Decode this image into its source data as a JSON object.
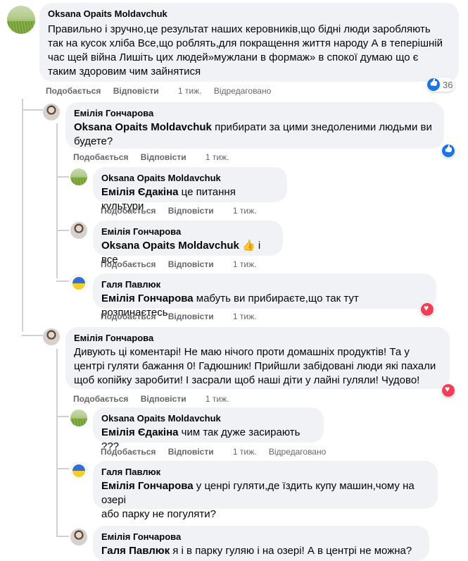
{
  "actions": {
    "like": "Подобається",
    "reply": "Відповісти"
  },
  "colors": {
    "like_blue": "#1b74e4",
    "love_red": "#f33e58",
    "bubble_bg": "#f0f2f5",
    "meta_gray": "#65676b"
  },
  "comments": [
    {
      "author": "Oksana Opaits Moldavchuk",
      "lines": [
        "Правильно і зручно,це результат наших керовників,що бідні люди заробляють",
        "так на кусок хліба Все,що роблять,для покращення життя народу А в теперішній",
        "час щей війна Лишіть цих людей»мужлани в формаж» в спокої думаю що є",
        "таким здоровим чим зайнятися"
      ],
      "time": "1 тиж.",
      "edited": "Відредаговано",
      "reaction_icon": "like-icon",
      "reaction_count": "36"
    },
    {
      "author": "Емілія Гончарова",
      "mention": "Oksana Opaits Moldavchuk",
      "line1_rest": " прибирати за цими знедоленими людьми ви",
      "line2": "будете?",
      "time": "1 тиж.",
      "reaction_icon": "like-icon"
    },
    {
      "author": "Oksana Opaits Moldavchuk",
      "mention": "Емілія Єдакіна",
      "rest": " це питання культури",
      "time": "1 тиж."
    },
    {
      "author": "Емілія Гончарова",
      "mention": "Oksana Opaits Moldavchuk",
      "emoji": "👍",
      "rest": " і все",
      "time": "1 тиж."
    },
    {
      "author": "Галя Павлюк",
      "mention": "Емілія Гончарова",
      "rest": " мабуть ви прибираєте,що так тут розпинаєтесь.",
      "time": "1 тиж.",
      "reaction_icon": "love-icon"
    },
    {
      "author": "Емілія Гончарова",
      "lines": [
        "Дивують ці коментарі! Не маю нічого проти домашніх продуктів! Та у",
        "центрі гуляти бажання 0! Гадюшник! Прийшли забідовані люди які пахали",
        "щоб копійку заробити! І засрали щоб наші діти у лайні гуляли! Чудово!"
      ],
      "time": "1 тиж.",
      "reaction_icon": "love-icon"
    },
    {
      "author": "Oksana Opaits Moldavchuk",
      "mention": "Емілія Єдакіна",
      "rest": " чим так дуже засирають ???",
      "time": "1 тиж.",
      "edited": "Відредаговано"
    },
    {
      "author": "Галя Павлюк",
      "mention": "Емілія Гончарова",
      "line1_rest": " у ценрі гуляти,де їздить купу машин,чому на озері",
      "line2": "або парку не погуляти?"
    },
    {
      "author": "Емілія Гончарова",
      "mention": "Галя Павлюк",
      "rest": " я і в парку гуляю і на озері! А в центрі не можна?"
    }
  ]
}
